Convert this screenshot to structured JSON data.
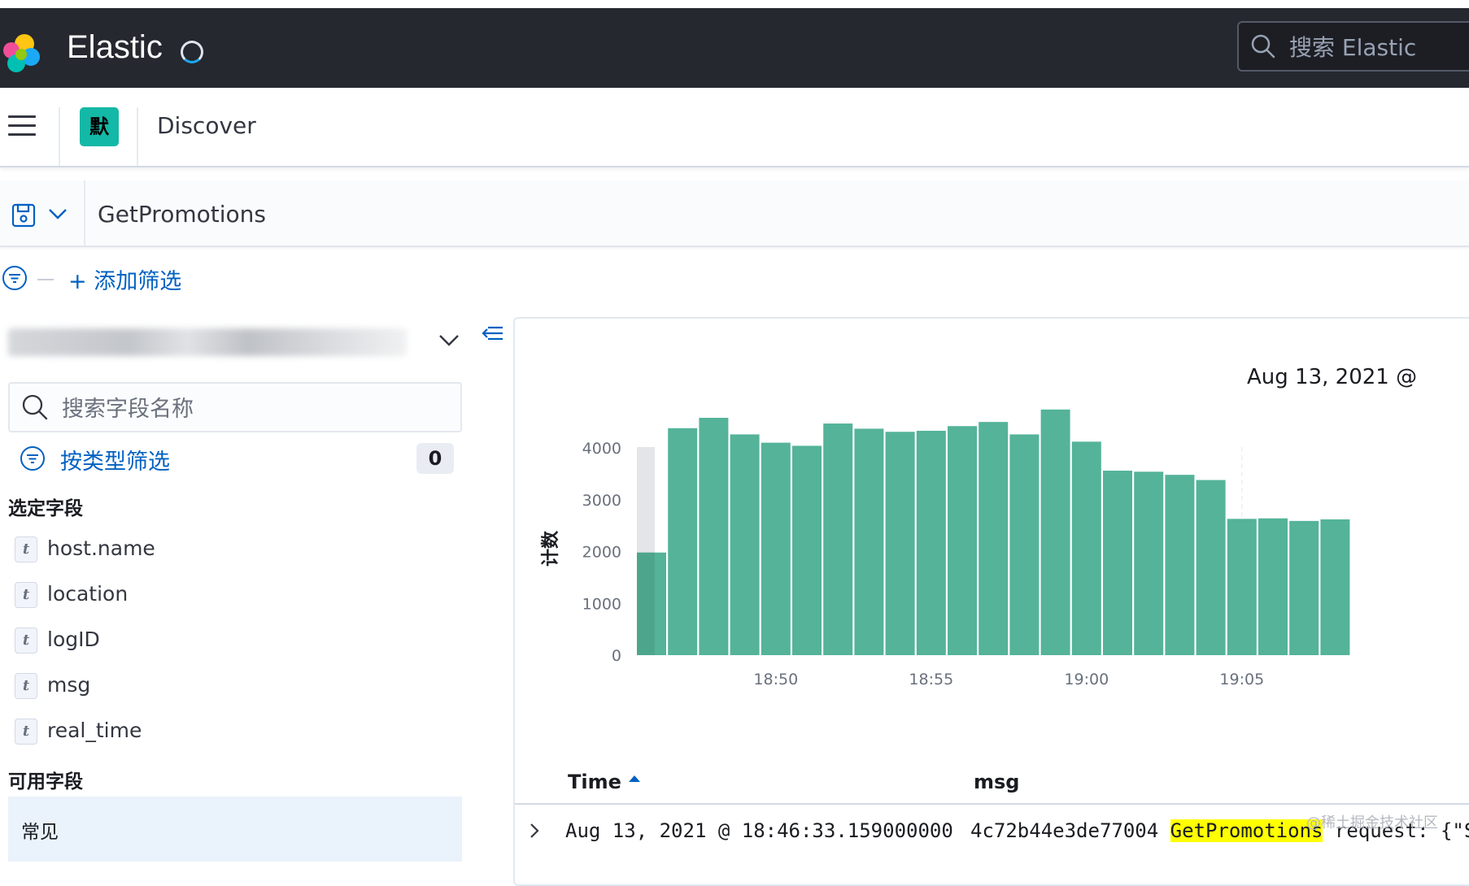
{
  "app": {
    "name": "Elastic",
    "search_placeholder": "搜索 Elastic"
  },
  "nav": {
    "space_initial": "默",
    "breadcrumb": "Discover"
  },
  "query": {
    "value": "GetPromotions"
  },
  "filters": {
    "add_label": "+ 添加筛选"
  },
  "sidebar": {
    "field_search_placeholder": "搜索字段名称",
    "type_filter_label": "按类型筛选",
    "type_filter_count": "0",
    "selected_title": "选定字段",
    "selected_fields": [
      {
        "type": "t",
        "name": "host.name"
      },
      {
        "type": "t",
        "name": "location"
      },
      {
        "type": "t",
        "name": "logID"
      },
      {
        "type": "t",
        "name": "msg"
      },
      {
        "type": "t",
        "name": "real_time"
      }
    ],
    "available_title": "可用字段",
    "common_group": "常见"
  },
  "chart_data": {
    "type": "bar",
    "title": "Aug 13, 2021 @",
    "ylabel": "计数",
    "xlabel": "",
    "ylim": [
      0,
      4800
    ],
    "yticks": [
      0,
      1000,
      2000,
      3000,
      4000
    ],
    "ytick_labels": [
      "0",
      "1000",
      "2000",
      "3000",
      "4000"
    ],
    "xtick_labels": [
      "18:50",
      "18:55",
      "19:00",
      "19:05"
    ],
    "xtick_bar_index": [
      4,
      9,
      14,
      19
    ],
    "color": "#54b399",
    "bars": [
      {
        "label": "18:46",
        "value": 1980,
        "partial": true
      },
      {
        "label": "18:47",
        "value": 4380
      },
      {
        "label": "18:48",
        "value": 4580
      },
      {
        "label": "18:49",
        "value": 4260
      },
      {
        "label": "18:50",
        "value": 4100
      },
      {
        "label": "18:51",
        "value": 4040
      },
      {
        "label": "18:52",
        "value": 4470
      },
      {
        "label": "18:53",
        "value": 4370
      },
      {
        "label": "18:54",
        "value": 4310
      },
      {
        "label": "18:55",
        "value": 4330
      },
      {
        "label": "18:56",
        "value": 4420
      },
      {
        "label": "18:57",
        "value": 4500
      },
      {
        "label": "18:58",
        "value": 4260
      },
      {
        "label": "18:59",
        "value": 4740
      },
      {
        "label": "19:00",
        "value": 4120
      },
      {
        "label": "19:01",
        "value": 3560
      },
      {
        "label": "19:02",
        "value": 3540
      },
      {
        "label": "19:03",
        "value": 3480
      },
      {
        "label": "19:04",
        "value": 3380
      },
      {
        "label": "19:05",
        "value": 2630
      },
      {
        "label": "19:06",
        "value": 2640
      },
      {
        "label": "19:07",
        "value": 2590
      },
      {
        "label": "19:08",
        "value": 2620
      }
    ]
  },
  "table": {
    "col_time": "Time",
    "col_msg": "msg",
    "rows": [
      {
        "time": "Aug 13, 2021 @ 18:46:33.159000000",
        "msg_prefix": "4c72b44e3de77004 ",
        "msg_highlight": "GetPromotions",
        "msg_suffix": " request: {\"S"
      }
    ]
  },
  "watermark": "@稀土掘金技术社区"
}
